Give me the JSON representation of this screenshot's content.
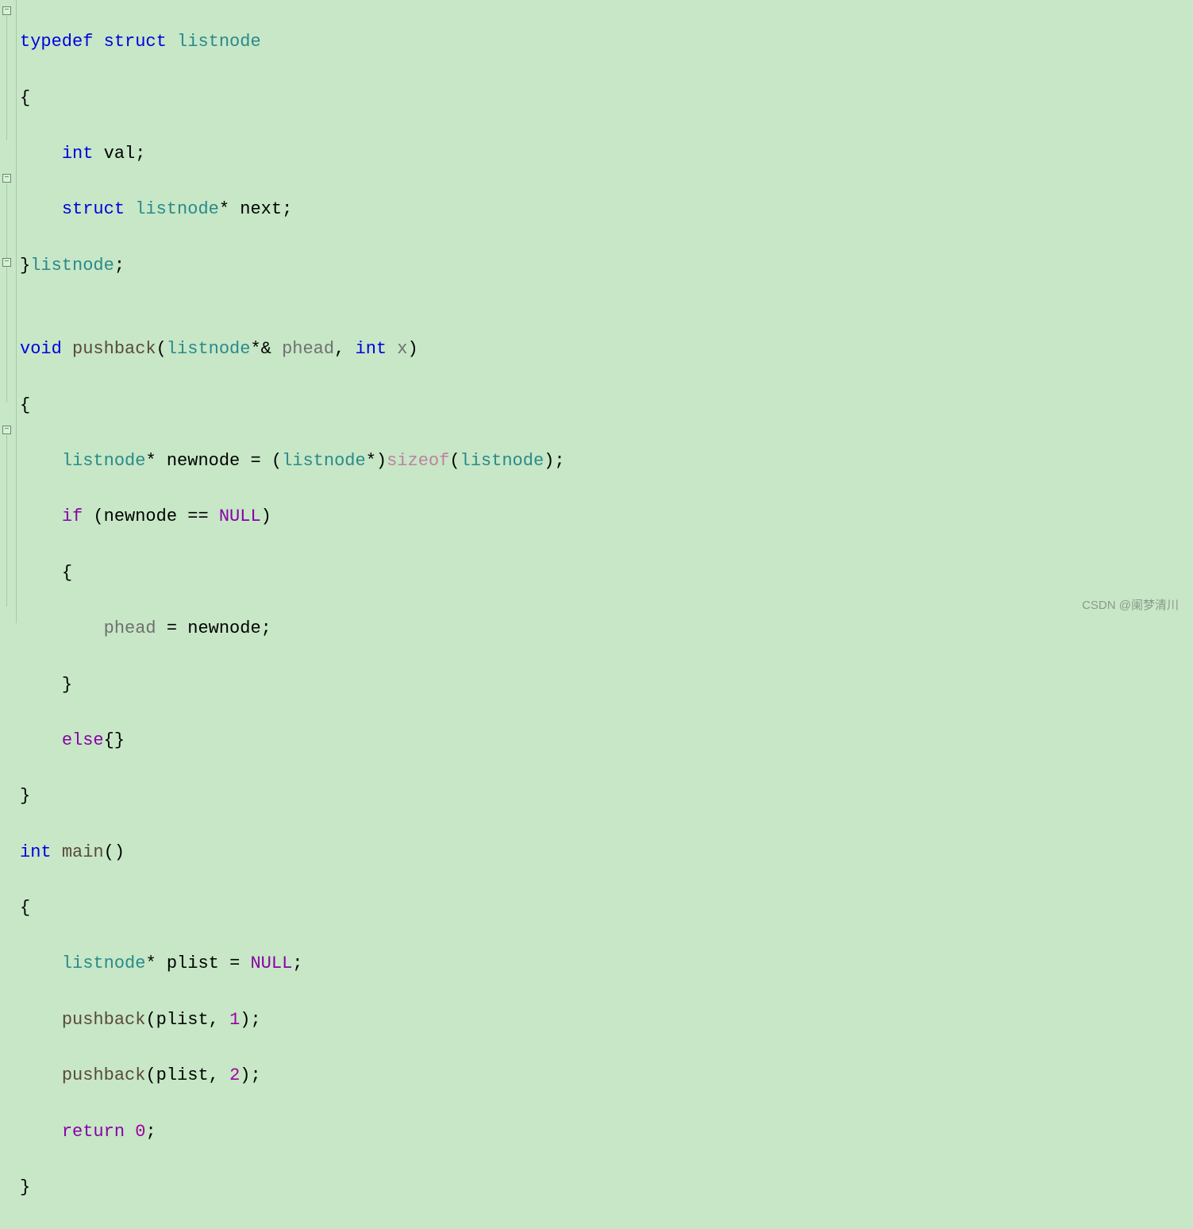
{
  "code": {
    "l1": {
      "typedef": "typedef",
      "struct": "struct",
      "listnode": "listnode"
    },
    "l2": {
      "brace": "{"
    },
    "l3": {
      "int": "int",
      "val": " val",
      "semi": ";"
    },
    "l4": {
      "struct": "struct",
      "listnode": "listnode",
      "star": "*",
      "next": " next",
      "semi": ";"
    },
    "l5": {
      "brace": "}",
      "listnode": "listnode",
      "semi": ";"
    },
    "l6": {
      "blank": ""
    },
    "l7": {
      "void": "void",
      "fn": "pushback",
      "lp": "(",
      "listnode1": "listnode",
      "star": "*",
      "amp": "& ",
      "phead": "phead",
      "comma": ", ",
      "int": "int",
      "x": " x",
      "rp": ")"
    },
    "l8": {
      "brace": "{"
    },
    "l9": {
      "listnode1": "listnode",
      "star1": "*",
      "newnode": " newnode ",
      "eq": "= ",
      "lp": "(",
      "listnode2": "listnode",
      "star2": "*",
      "rp": ")",
      "sizeof": "sizeof",
      "lp2": "(",
      "listnode3": "listnode",
      "rp2": ")",
      "semi": ";"
    },
    "l10": {
      "if": "if",
      "lp": " (",
      "newnode": "newnode ",
      "eqeq": "== ",
      "null": "NULL",
      "rp": ")"
    },
    "l11": {
      "brace": "{"
    },
    "l12": {
      "phead": "phead ",
      "eq": "= ",
      "newnode": "newnode",
      "semi": ";"
    },
    "l13": {
      "brace": "}"
    },
    "l14": {
      "else": "else",
      "lb": "{",
      "rb": "}"
    },
    "l15": {
      "brace": "}"
    },
    "l16": {
      "int": "int",
      "main": "main",
      "lp": "(",
      "rp": ")"
    },
    "l17": {
      "brace": "{"
    },
    "l18": {
      "listnode": "listnode",
      "star": "*",
      "plist": " plist ",
      "eq": "= ",
      "null": "NULL",
      "semi": ";"
    },
    "l19": {
      "fn": "pushback",
      "lp": "(",
      "plist": "plist",
      "comma": ", ",
      "n": "1",
      "rp": ")",
      "semi": ";"
    },
    "l20": {
      "fn": "pushback",
      "lp": "(",
      "plist": "plist",
      "comma": ", ",
      "n": "2",
      "rp": ")",
      "semi": ";"
    },
    "l21": {
      "return": "return",
      "sp": " ",
      "n": "0",
      "semi": ";"
    },
    "l22": {
      "brace": "}"
    }
  },
  "fold_marks": [
    "−",
    "−",
    "−",
    "−"
  ],
  "watermark": "CSDN @阑梦清川"
}
